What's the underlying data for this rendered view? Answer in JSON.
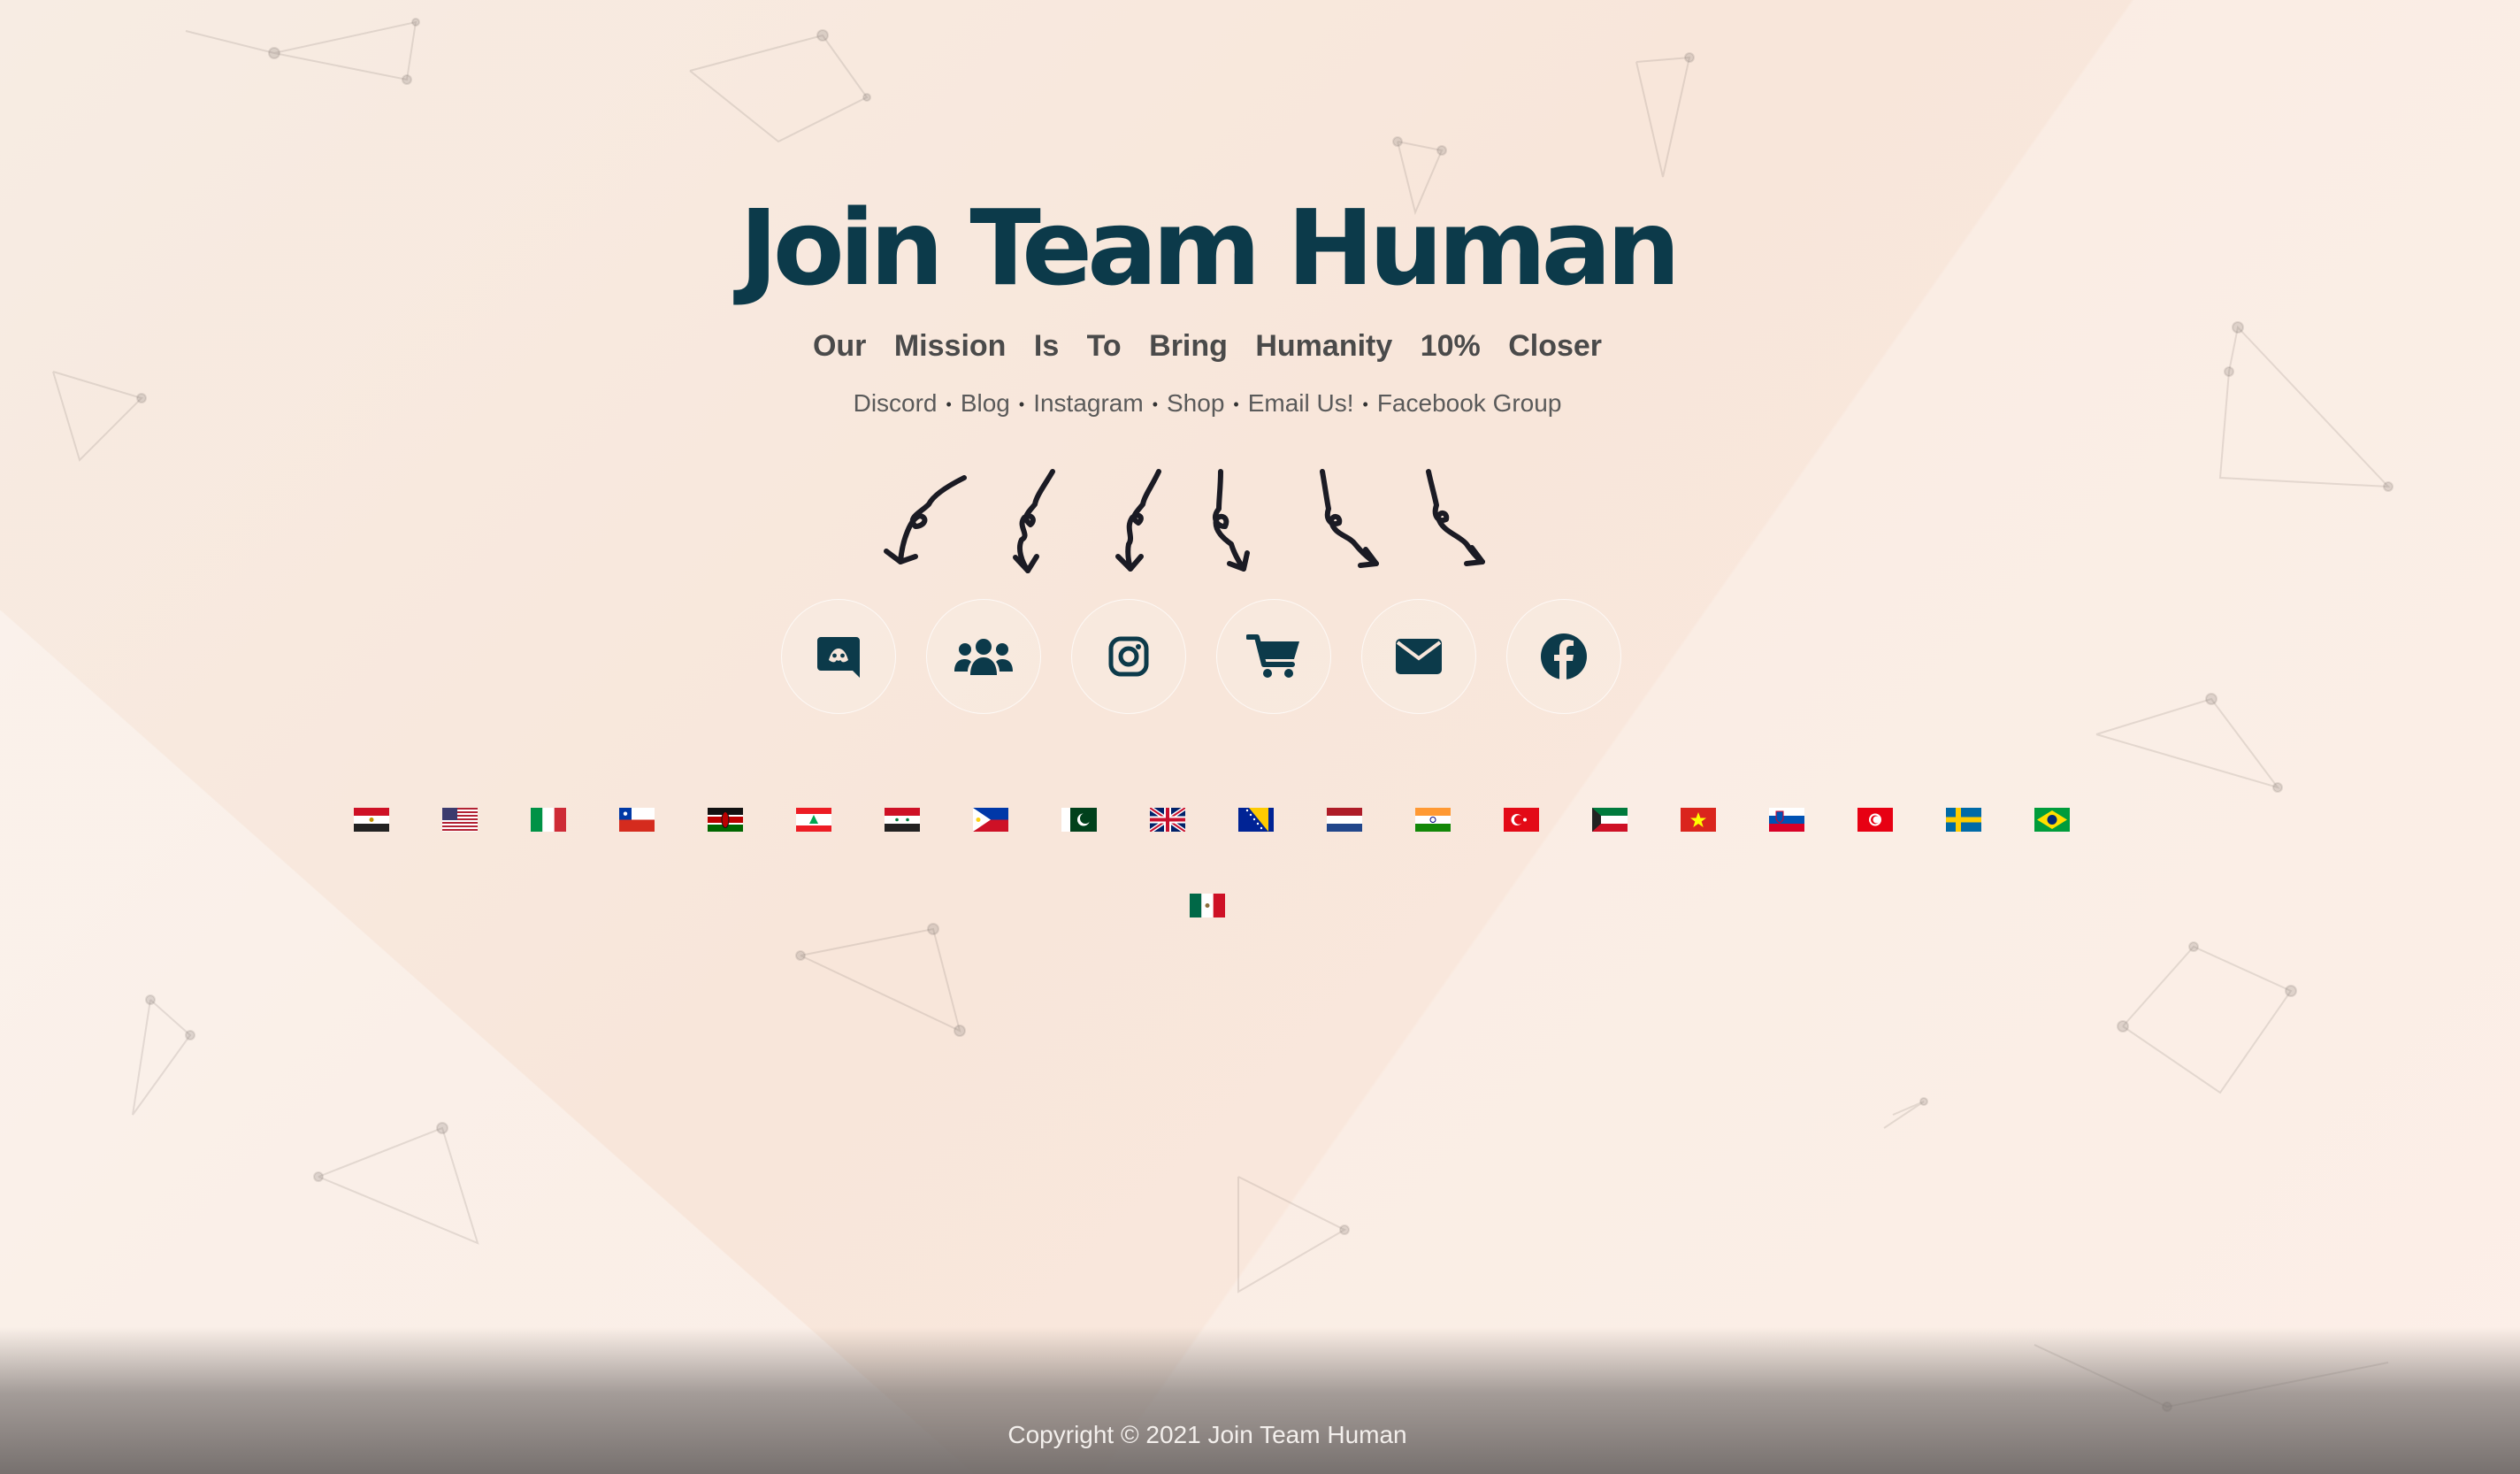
{
  "hero": {
    "title": "Join Team Human",
    "subtitle": "Our Mission Is To Bring Humanity 10% Closer"
  },
  "nav_links": [
    {
      "label": "Discord"
    },
    {
      "label": "Blog"
    },
    {
      "label": "Instagram"
    },
    {
      "label": "Shop"
    },
    {
      "label": "Email Us!"
    },
    {
      "label": "Facebook Group"
    }
  ],
  "separator": "•",
  "social_icons": [
    "discord-icon",
    "users-group-icon",
    "instagram-icon",
    "cart-icon",
    "envelope-icon",
    "facebook-icon"
  ],
  "flags": [
    "egypt",
    "united-states",
    "italy",
    "chile",
    "kenya",
    "lebanon",
    "syria",
    "philippines",
    "pakistan",
    "united-kingdom",
    "bosnia",
    "netherlands",
    "india",
    "turkey",
    "kuwait",
    "vietnam",
    "slovenia",
    "tunisia",
    "sweden",
    "brazil",
    "mexico"
  ],
  "colors": {
    "title": "#0c3a4a",
    "icon": "#0c3a4a",
    "background": "#f8e6da"
  },
  "footer": {
    "copyright": "Copyright © 2021 Join Team Human"
  }
}
